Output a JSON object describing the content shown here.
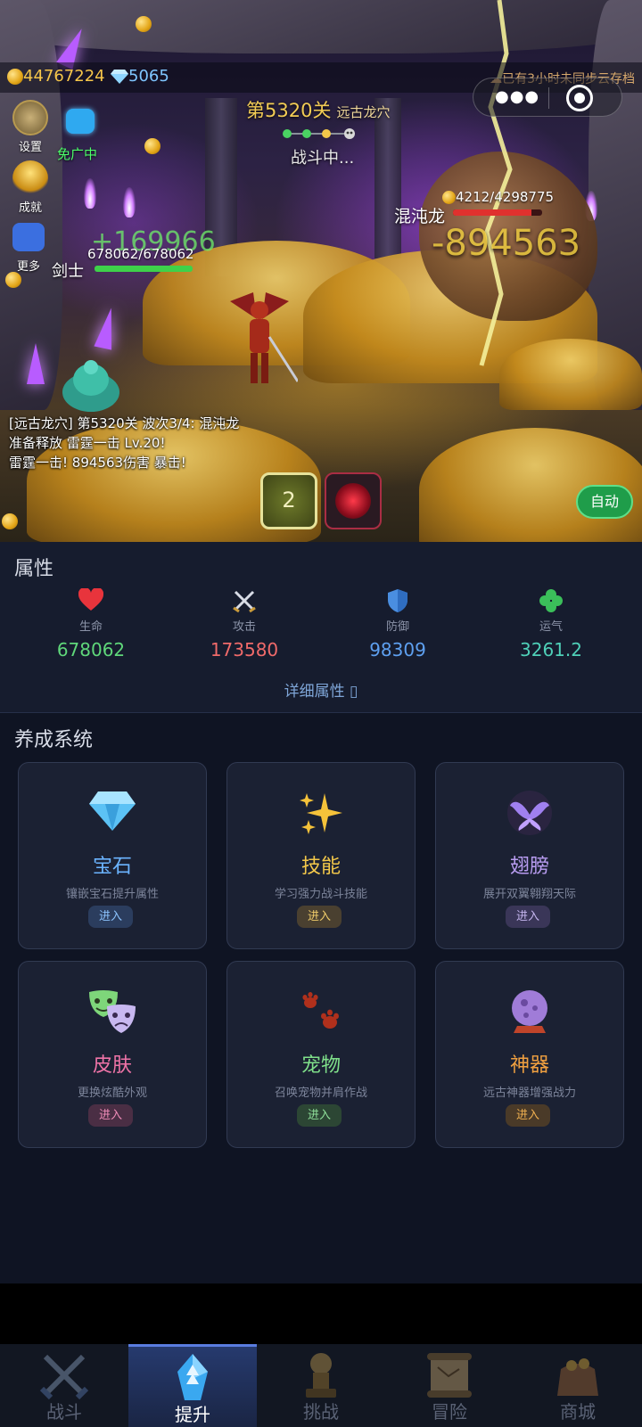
{
  "resources": {
    "gold": "44767224",
    "gems": "5065"
  },
  "cloud_save_notice": "已有3小时未同步云存档",
  "side_buttons": {
    "settings": "设置",
    "achievements": "成就",
    "more": "更多"
  },
  "ad_status": "免广中",
  "stage": {
    "title": "第5320关",
    "location": "远古龙穴",
    "status": "战斗中..."
  },
  "enemy": {
    "name": "混沌龙",
    "hp_text": "4212/4298775",
    "hp_fraction": 0.88,
    "damage_float": "-894563"
  },
  "player": {
    "name": "剑士",
    "hp_text": "678062/678062",
    "hp_fraction": 1.0,
    "heal_float": "+169966"
  },
  "battle_log": [
    "[远古龙穴] 第5320关 波次3/4: 混沌龙",
    "准备释放 雷霆一击 Lv.20!",
    "雷霆一击! 894563伤害 暴击!"
  ],
  "skill_slot_1": "2",
  "auto_button": "自动",
  "attributes": {
    "title": "属性",
    "items": [
      {
        "icon": "heart-icon",
        "label": "生命",
        "value": "678062",
        "color": "#5fd77a"
      },
      {
        "icon": "swords-icon",
        "label": "攻击",
        "value": "173580",
        "color": "#f06a6a"
      },
      {
        "icon": "shield-icon",
        "label": "防御",
        "value": "98309",
        "color": "#5ea0f0"
      },
      {
        "icon": "clover-icon",
        "label": "运气",
        "value": "3261.2",
        "color": "#4fd0b8"
      }
    ],
    "detail_link": "详细属性 ▯"
  },
  "cultivation": {
    "title": "养成系统",
    "cards": [
      {
        "icon": "gem-icon",
        "title": "宝石",
        "desc": "镶嵌宝石提升属性",
        "button": "进入",
        "title_color": "#6bb4ff",
        "btn_bg": "#2b3d5e",
        "btn_fg": "#8cc4ff"
      },
      {
        "icon": "sparkles-icon",
        "title": "技能",
        "desc": "学习强力战斗技能",
        "button": "进入",
        "title_color": "#f3c84a",
        "btn_bg": "#4a4030",
        "btn_fg": "#f0cc6a"
      },
      {
        "icon": "wings-icon",
        "title": "翅膀",
        "desc": "展开双翼翱翔天际",
        "button": "进入",
        "title_color": "#b89cf0",
        "btn_bg": "#3a3658",
        "btn_fg": "#c6b6f0"
      },
      {
        "icon": "masks-icon",
        "title": "皮肤",
        "desc": "更换炫酷外观",
        "button": "进入",
        "title_color": "#f074a8",
        "btn_bg": "#4a2e44",
        "btn_fg": "#f08cb8"
      },
      {
        "icon": "paw-icon",
        "title": "宠物",
        "desc": "召唤宠物并肩作战",
        "button": "进入",
        "title_color": "#7fe08a",
        "btn_bg": "#2c4634",
        "btn_fg": "#8fe09a"
      },
      {
        "icon": "orb-icon",
        "title": "神器",
        "desc": "远古神器增强战力",
        "button": "进入",
        "title_color": "#f0a040",
        "btn_bg": "#4a3a28",
        "btn_fg": "#f0b050"
      }
    ]
  },
  "bottom_nav": [
    {
      "label": "战斗",
      "icon": "crossed-swords-icon",
      "active": false
    },
    {
      "label": "提升",
      "icon": "upgrade-crystal-icon",
      "active": true
    },
    {
      "label": "挑战",
      "icon": "trophy-statue-icon",
      "active": false
    },
    {
      "label": "冒险",
      "icon": "map-scroll-icon",
      "active": false
    },
    {
      "label": "商城",
      "icon": "shop-bag-icon",
      "active": false
    }
  ]
}
